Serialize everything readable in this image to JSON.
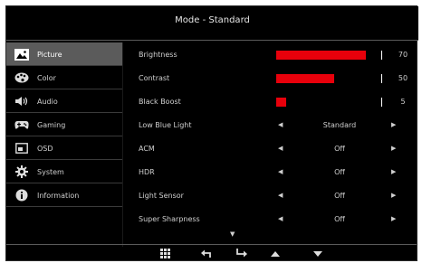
{
  "header": {
    "title": "Mode - Standard"
  },
  "sidebar": {
    "items": [
      {
        "label": "Picture",
        "icon": "picture-icon",
        "active": true
      },
      {
        "label": "Color",
        "icon": "palette-icon",
        "active": false
      },
      {
        "label": "Audio",
        "icon": "speaker-icon",
        "active": false
      },
      {
        "label": "Gaming",
        "icon": "gamepad-icon",
        "active": false
      },
      {
        "label": "OSD",
        "icon": "osd-icon",
        "active": false
      },
      {
        "label": "System",
        "icon": "gear-icon",
        "active": false
      },
      {
        "label": "Information",
        "icon": "info-icon",
        "active": false
      }
    ]
  },
  "settings": {
    "brightness": {
      "label": "Brightness",
      "value": "70",
      "level": 0.85
    },
    "contrast": {
      "label": "Contrast",
      "value": "50",
      "level": 0.55
    },
    "black_boost": {
      "label": "Black Boost",
      "value": "5",
      "level": 0.09
    },
    "low_blue_light": {
      "label": "Low Blue Light",
      "value": "Standard"
    },
    "acm": {
      "label": "ACM",
      "value": "Off"
    },
    "hdr": {
      "label": "HDR",
      "value": "Off"
    },
    "light_sensor": {
      "label": "Light Sensor",
      "value": "Off"
    },
    "super_sharpness": {
      "label": "Super Sharpness",
      "value": "Off"
    }
  },
  "footer": {
    "buttons": [
      "menu-grid-icon",
      "back-icon",
      "enter-icon",
      "up-icon",
      "down-icon"
    ]
  },
  "colors": {
    "accent": "#e8000b",
    "active_bg": "#5b5b5b"
  }
}
